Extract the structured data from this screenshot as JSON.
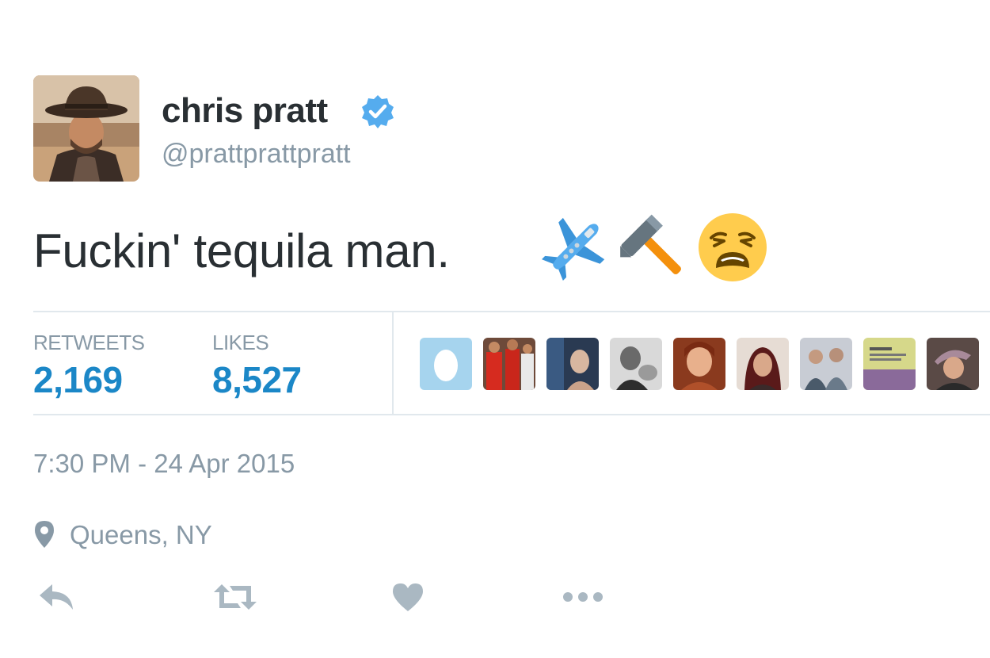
{
  "user": {
    "display_name": "chris pratt",
    "handle": "@prattprattpratt",
    "verified": true
  },
  "tweet": {
    "text": "Fuckin' tequila man.",
    "emojis": [
      "airplane",
      "hammer",
      "weary-face"
    ]
  },
  "stats": {
    "retweets_label": "RETWEETS",
    "retweets_value": "2,169",
    "likes_label": "LIKES",
    "likes_value": "8,527",
    "liker_avatars": [
      "egg-avatar",
      "avatar-2",
      "avatar-3",
      "avatar-4",
      "avatar-5",
      "avatar-6",
      "avatar-7",
      "avatar-8",
      "avatar-9"
    ]
  },
  "meta": {
    "timestamp": "7:30 PM - 24 Apr 2015",
    "location": "Queens, NY"
  },
  "actions": [
    "reply-icon",
    "retweet-icon",
    "heart-icon",
    "more-icon"
  ],
  "colors": {
    "link_blue": "#1b87c7",
    "verified_blue": "#55acee",
    "muted": "#8899a6",
    "text": "#292f33",
    "divider": "#e1e8ed"
  }
}
